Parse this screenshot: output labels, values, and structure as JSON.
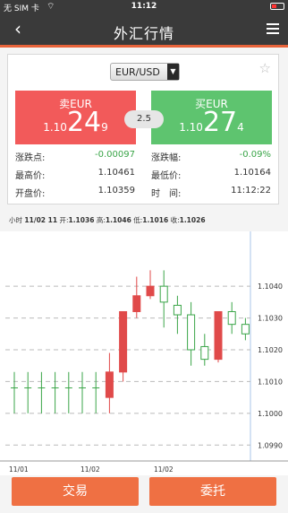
{
  "status": {
    "carrier": "无 SIM 卡",
    "time": "11:12"
  },
  "nav": {
    "title": "外汇行情"
  },
  "pair": {
    "selected": "EUR/USD"
  },
  "sell": {
    "label": "卖EUR",
    "prefix": "1.10",
    "big": "24",
    "suffix": "9"
  },
  "buy": {
    "label": "买EUR",
    "prefix": "1.10",
    "big": "27",
    "suffix": "4"
  },
  "spread": "2.5",
  "stats": {
    "change_label": "涨跌点:",
    "change_value": "-0.00097",
    "change_pct_label": "涨跌幅:",
    "change_pct_value": "-0.09%",
    "high_label": "最高价:",
    "high_value": "1.10461",
    "low_label": "最低价:",
    "low_value": "1.10164",
    "open_label": "开盘价:",
    "open_value": "1.10359",
    "time_label": "时　间:",
    "time_value": "11:12:22"
  },
  "ohlc": {
    "period": "小时",
    "date": "11/02 11",
    "open_label": "开:",
    "open": "1.1036",
    "high_label": "高:",
    "high": "1.1046",
    "low_label": "低:",
    "low": "1.1016",
    "close_label": "收:",
    "close": "1.1026"
  },
  "buttons": {
    "trade": "交易",
    "order": "委托"
  },
  "colors": {
    "accent": "#ef7043",
    "up": "#3aa548",
    "down": "#e04a4a",
    "header": "#3a3a3a"
  },
  "chart_data": {
    "type": "candlestick",
    "ylim": [
      1.0985,
      1.1055
    ],
    "y_ticks": [
      "1.1040",
      "1.1030",
      "1.1020",
      "1.1010",
      "1.1000",
      "1.0990"
    ],
    "x_ticks": [
      "11/01",
      "11/02",
      "11/02"
    ],
    "candles": [
      {
        "open": 1.1008,
        "high": 1.1013,
        "low": 1.1,
        "close": 1.1008
      },
      {
        "open": 1.1008,
        "high": 1.1013,
        "low": 1.1,
        "close": 1.1008
      },
      {
        "open": 1.1008,
        "high": 1.1013,
        "low": 1.1,
        "close": 1.1008
      },
      {
        "open": 1.1008,
        "high": 1.1013,
        "low": 1.1,
        "close": 1.1008
      },
      {
        "open": 1.1008,
        "high": 1.1013,
        "low": 1.1,
        "close": 1.1008
      },
      {
        "open": 1.1008,
        "high": 1.1013,
        "low": 1.1,
        "close": 1.1008
      },
      {
        "open": 1.1008,
        "high": 1.1013,
        "low": 1.1,
        "close": 1.1008
      },
      {
        "open": 1.1013,
        "high": 1.1019,
        "low": 1.1,
        "close": 1.1005
      },
      {
        "open": 1.1032,
        "high": 1.1032,
        "low": 1.101,
        "close": 1.1013
      },
      {
        "open": 1.1037,
        "high": 1.1043,
        "low": 1.103,
        "close": 1.1032
      },
      {
        "open": 1.104,
        "high": 1.1045,
        "low": 1.1036,
        "close": 1.1037
      },
      {
        "open": 1.1035,
        "high": 1.1045,
        "low": 1.1027,
        "close": 1.104
      },
      {
        "open": 1.1031,
        "high": 1.1037,
        "low": 1.1025,
        "close": 1.1034
      },
      {
        "open": 1.102,
        "high": 1.1035,
        "low": 1.1015,
        "close": 1.1031
      },
      {
        "open": 1.1017,
        "high": 1.1025,
        "low": 1.1015,
        "close": 1.1021
      },
      {
        "open": 1.1032,
        "high": 1.1032,
        "low": 1.1016,
        "close": 1.1017
      },
      {
        "open": 1.1028,
        "high": 1.1035,
        "low": 1.1025,
        "close": 1.1032
      },
      {
        "open": 1.1025,
        "high": 1.103,
        "low": 1.1023,
        "close": 1.1028
      }
    ]
  }
}
